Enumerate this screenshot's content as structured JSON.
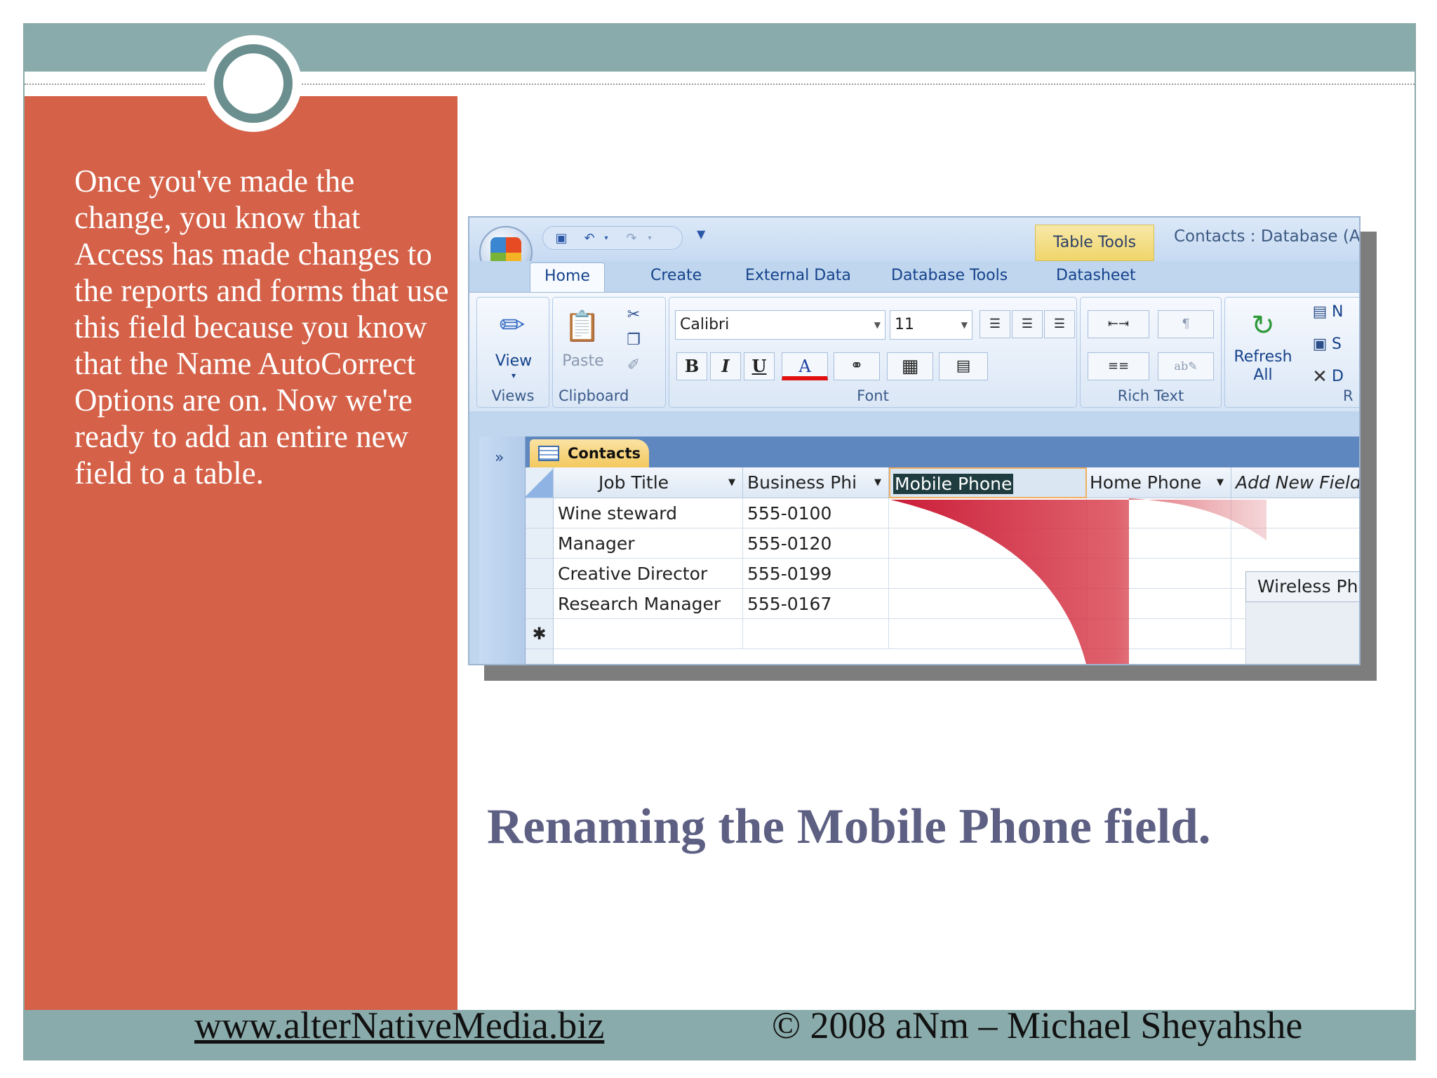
{
  "slide": {
    "body_text": "Once you've made the change, you know that Access has made changes to the reports and forms that use this field because you know that the Name AutoCorrect Options are on. Now we're ready to add an entire new field to a table.",
    "caption": "Renaming the Mobile Phone field.",
    "footer_link": "www.alterNativeMedia.biz",
    "footer_copyright": "© 2008 aNm – Michael Sheyahshe"
  },
  "colors": {
    "left_panel": "#d46148",
    "band": "#8aabab",
    "caption": "#5d5f83"
  },
  "access": {
    "context_tab": "Table Tools",
    "window_title": "Contacts : Database (Ac",
    "quick_access_icons": [
      "save-icon",
      "undo-icon",
      "redo-icon",
      "customize-icon"
    ],
    "tabs": [
      {
        "label": "Home",
        "active": true
      },
      {
        "label": "Create",
        "active": false
      },
      {
        "label": "External Data",
        "active": false
      },
      {
        "label": "Database Tools",
        "active": false
      },
      {
        "label": "Datasheet",
        "active": false
      }
    ],
    "ribbon": {
      "views": {
        "button": "View",
        "group": "Views"
      },
      "clipboard": {
        "button": "Paste",
        "group": "Clipboard"
      },
      "font": {
        "family": "Calibri",
        "size": "11",
        "group": "Font",
        "bold": "B",
        "italic": "I",
        "underline": "U",
        "font_color": "A"
      },
      "rich_text": {
        "group": "Rich Text"
      },
      "records": {
        "button_line1": "Refresh",
        "button_line2": "All",
        "group_initial": "R",
        "item_initials": [
          "N",
          "S",
          "D"
        ]
      }
    },
    "nav_toggle": "»",
    "doc_tab": "Contacts",
    "columns": [
      "Job Title",
      "Business Phi",
      "Mobile Phone",
      "Home Phone",
      "Add New Field"
    ],
    "rows": [
      {
        "job_title": "Wine steward",
        "business_phone": "555-0100"
      },
      {
        "job_title": "Manager",
        "business_phone": "555-0120"
      },
      {
        "job_title": "Creative Director",
        "business_phone": "555-0199"
      },
      {
        "job_title": "Research Manager",
        "business_phone": "555-0167"
      }
    ],
    "new_row_marker": "✱",
    "drag_field": "Wireless Phone"
  }
}
